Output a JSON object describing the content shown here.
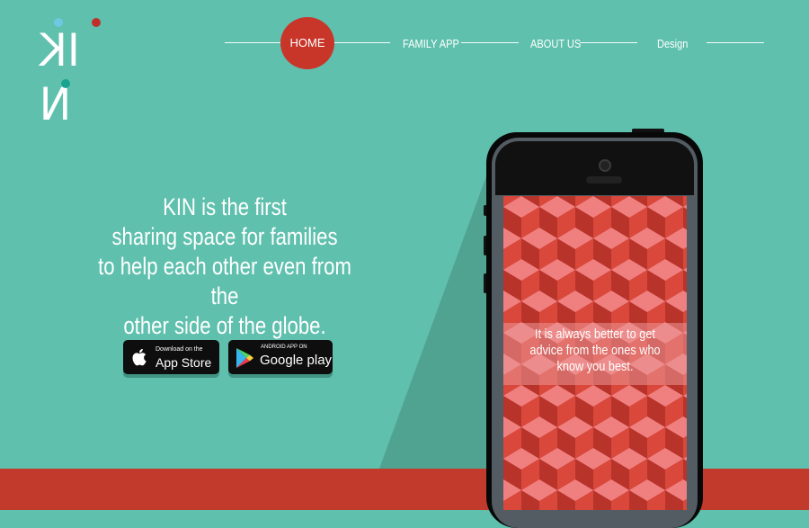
{
  "brand": {
    "logo_text": "KIN",
    "colors": {
      "background": "#5fc0ad",
      "accent": "#c8362a",
      "floor": "#c23a2b",
      "dot_blue": "#6fc8e2",
      "dot_teal": "#1aa48f"
    }
  },
  "nav": {
    "home": "HOME",
    "family_app": "FAMILY APP",
    "about_us": "ABOUT US",
    "design": "Design"
  },
  "hero": {
    "headline_lines": [
      "KIN is the first",
      "sharing space for families",
      "to help each other even from the",
      "other side of the globe."
    ]
  },
  "badges": {
    "apple_small": "Download on the",
    "apple_big": "App Store",
    "apple_icon": "apple-icon",
    "google_small": "ANDROID APP ON",
    "google_big": "Google play",
    "google_icon": "google-play-icon"
  },
  "phone": {
    "quote_lines": [
      "It is always better to get",
      "advice from the ones who",
      "know you best."
    ]
  }
}
